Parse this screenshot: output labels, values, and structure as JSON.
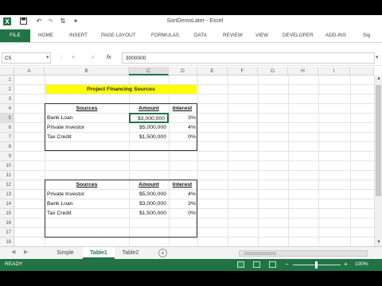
{
  "window": {
    "title": "SortDemoLater - Excel"
  },
  "ribbon": {
    "file_label": "FILE",
    "tabs": [
      "HOME",
      "INSERT",
      "PAGE LAYOUT",
      "FORMULAS",
      "DATA",
      "REVIEW",
      "VIEW",
      "DEVELOPER",
      "ADD-INS",
      "Sig"
    ]
  },
  "formula_bar": {
    "name_box": "C5",
    "cancel_symbol": "×",
    "enter_symbol": "✓",
    "fx_label": "fx",
    "value": "3000000"
  },
  "grid": {
    "columns": [
      "A",
      "B",
      "C",
      "D",
      "E",
      "F",
      "G",
      "H",
      "I"
    ],
    "selected_column": "C",
    "rows": [
      "1",
      "2",
      "3",
      "4",
      "5",
      "6",
      "7",
      "8",
      "9",
      "10",
      "11",
      "12",
      "13",
      "14",
      "15",
      "16",
      "17",
      "18"
    ],
    "selected_row": "5",
    "banner": "Project Financing Sources",
    "table1": {
      "headers": [
        "Sources",
        "Amount",
        "Interest"
      ],
      "rows": [
        [
          "Bank Loan",
          "$3,000,000",
          "3%"
        ],
        [
          "Private Investor",
          "$5,000,000",
          "4%"
        ],
        [
          "Tax Credit",
          "$1,500,000",
          "0%"
        ]
      ]
    },
    "table2": {
      "headers": [
        "Sources",
        "Amount",
        "Interest"
      ],
      "rows": [
        [
          "Private Investor",
          "$5,000,000",
          "4%"
        ],
        [
          "Bank Loan",
          "$3,000,000",
          "3%"
        ],
        [
          "Tax Credit",
          "$1,500,000",
          "0%"
        ]
      ]
    }
  },
  "sheets": {
    "tabs": [
      "Simple",
      "Table1",
      "Table2"
    ],
    "active": "Table1",
    "add_symbol": "+"
  },
  "status": {
    "ready": "READY",
    "zoom": "100%",
    "zoom_out": "−",
    "zoom_in": "+"
  },
  "colors": {
    "excel_green": "#217346",
    "banner_yellow": "#ffff00"
  }
}
